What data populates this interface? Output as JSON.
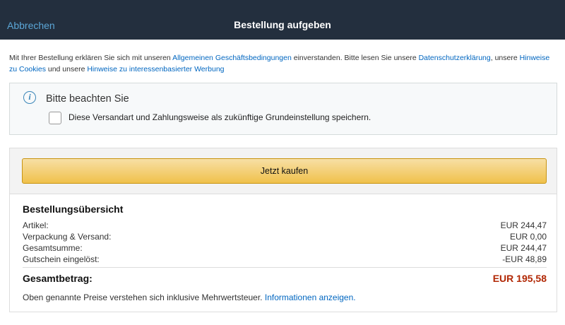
{
  "header": {
    "cancel_label": "Abbrechen",
    "title": "Bestellung aufgeben"
  },
  "legal": {
    "part1": "Mit Ihrer Bestellung erklären Sie sich mit unseren ",
    "link_agb": "Allgemeinen Geschäftsbedingungen",
    "part2": " einverstanden. Bitte lesen Sie unsere ",
    "link_privacy": "Datenschutzerklärung",
    "part3": ", unsere ",
    "link_cookies": "Hinweise zu Cookies",
    "part4": " und unsere ",
    "link_ads": "Hinweise zu interessenbasierter Werbung"
  },
  "notice": {
    "icon": "info-icon",
    "title": "Bitte beachten Sie",
    "checkbox_label": "Diese Versandart und Zahlungsweise als zukünftige Grundeinstellung speichern.",
    "checked": false
  },
  "buy_button": {
    "label": "Jetzt kaufen"
  },
  "summary": {
    "title": "Bestellungsübersicht",
    "rows": [
      {
        "label": "Artikel:",
        "value": "EUR 244,47"
      },
      {
        "label": "Verpackung & Versand:",
        "value": "EUR 0,00"
      },
      {
        "label": "Gesamtsumme:",
        "value": "EUR 244,47"
      },
      {
        "label": "Gutschein eingelöst:",
        "value": "-EUR 48,89"
      }
    ],
    "total_label": "Gesamtbetrag:",
    "total_value": "EUR 195,58",
    "tax_note": "Oben genannte Preise verstehen sich inklusive Mehrwertsteuer. ",
    "tax_link": "Informationen anzeigen."
  },
  "colors": {
    "header_bg": "#232f3e",
    "link": "#0066c0",
    "total_price": "#b12704",
    "button": "#f0c14b"
  }
}
